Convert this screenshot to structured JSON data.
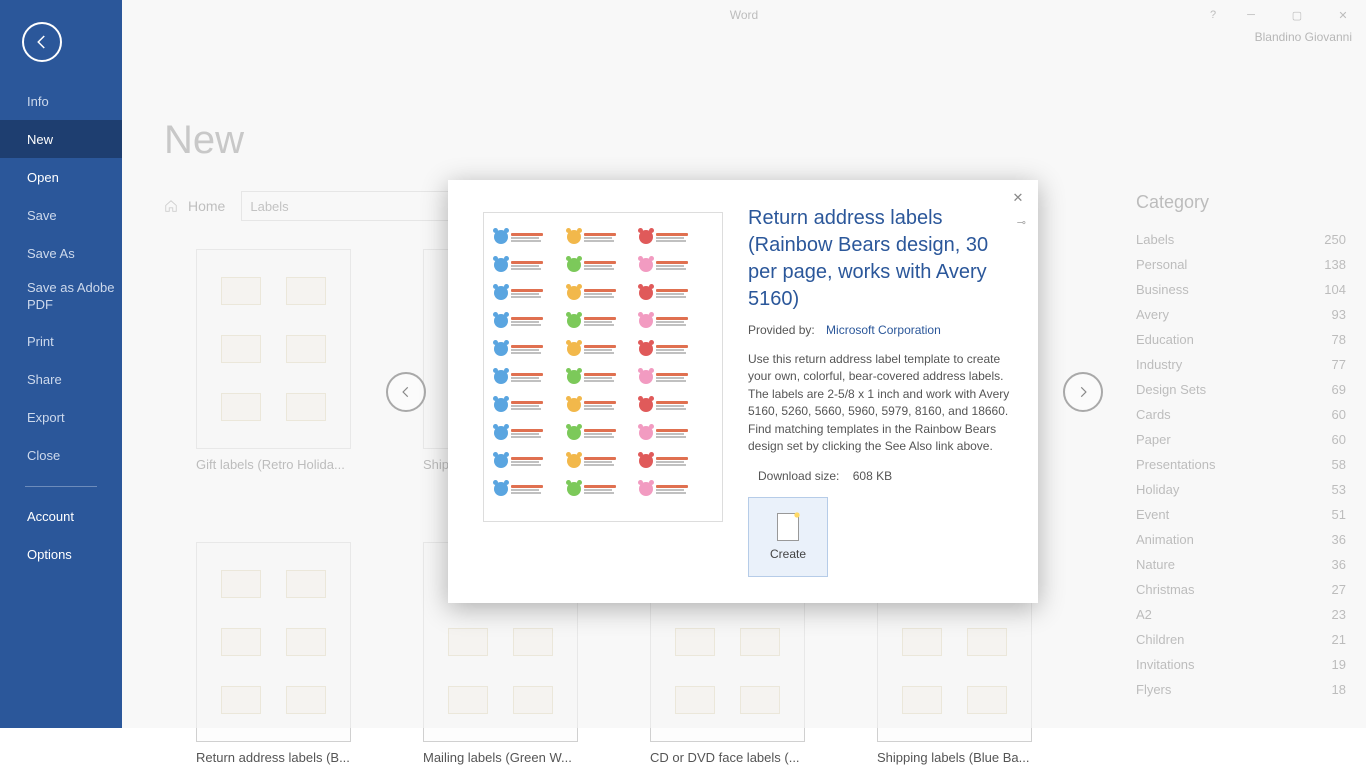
{
  "titlebar": {
    "app": "Word"
  },
  "user": "Blandino Giovanni",
  "sidebar": {
    "items": [
      {
        "label": "Info"
      },
      {
        "label": "New"
      },
      {
        "label": "Open"
      },
      {
        "label": "Save"
      },
      {
        "label": "Save As"
      },
      {
        "label": "Save as Adobe PDF"
      },
      {
        "label": "Print"
      },
      {
        "label": "Share"
      },
      {
        "label": "Export"
      },
      {
        "label": "Close"
      }
    ],
    "footer": [
      {
        "label": "Account"
      },
      {
        "label": "Options"
      }
    ]
  },
  "page": {
    "title": "New",
    "breadcrumb": "Home",
    "search": "Labels"
  },
  "templates": [
    {
      "name": "Gift labels (Retro Holida..."
    },
    {
      "name": "Ship..."
    },
    {
      "name": ""
    },
    {
      "name": ""
    },
    {
      "name": "Return address labels (B..."
    },
    {
      "name": "Mailing labels (Green W..."
    },
    {
      "name": "CD or DVD face labels (..."
    },
    {
      "name": "Shipping labels (Blue Ba..."
    }
  ],
  "category": {
    "title": "Category",
    "items": [
      {
        "label": "Labels",
        "count": "250"
      },
      {
        "label": "Personal",
        "count": "138"
      },
      {
        "label": "Business",
        "count": "104"
      },
      {
        "label": "Avery",
        "count": "93"
      },
      {
        "label": "Education",
        "count": "78"
      },
      {
        "label": "Industry",
        "count": "77"
      },
      {
        "label": "Design Sets",
        "count": "69"
      },
      {
        "label": "Cards",
        "count": "60"
      },
      {
        "label": "Paper",
        "count": "60"
      },
      {
        "label": "Presentations",
        "count": "58"
      },
      {
        "label": "Holiday",
        "count": "53"
      },
      {
        "label": "Event",
        "count": "51"
      },
      {
        "label": "Animation",
        "count": "36"
      },
      {
        "label": "Nature",
        "count": "36"
      },
      {
        "label": "Christmas",
        "count": "27"
      },
      {
        "label": "A2",
        "count": "23"
      },
      {
        "label": "Children",
        "count": "21"
      },
      {
        "label": "Invitations",
        "count": "19"
      },
      {
        "label": "Flyers",
        "count": "18"
      }
    ]
  },
  "modal": {
    "title": "Return address labels (Rainbow Bears design, 30 per page, works with Avery 5160)",
    "provided_label": "Provided by:",
    "provider": "Microsoft Corporation",
    "description": "Use this return address label template to create your own, colorful, bear-covered address labels. The labels are 2-5/8 x 1 inch and work with Avery 5160, 5260, 5660, 5960, 5979, 8160, and 18660. Find matching templates in the Rainbow Bears design set by clicking the See Also link above.",
    "download_label": "Download size:",
    "download_size": "608 KB",
    "create": "Create"
  }
}
